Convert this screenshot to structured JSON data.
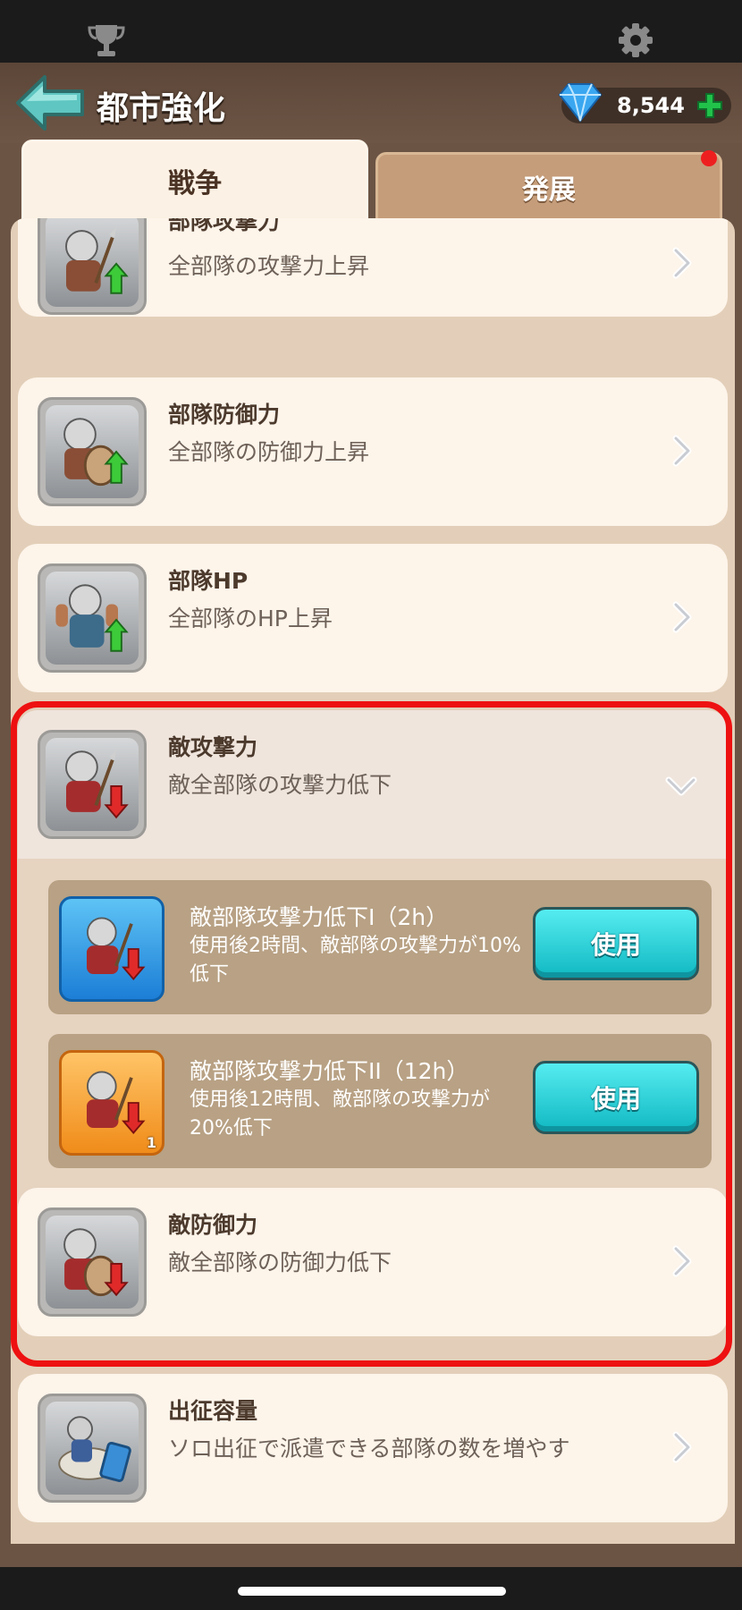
{
  "header": {
    "title": "都市強化",
    "gems": "8,544",
    "colors": {
      "gem": "#3aa7f0",
      "plus": "#21c24a"
    }
  },
  "tabs": [
    {
      "label": "戦争",
      "active": true
    },
    {
      "label": "発展",
      "active": false,
      "notification": true
    }
  ],
  "cards": [
    {
      "title": "部隊攻撃力",
      "desc": "全部隊の攻撃力上昇",
      "icon": "soldier-spear-attack-up-icon",
      "arrow": "up"
    },
    {
      "title": "部隊防御力",
      "desc": "全部隊の防御力上昇",
      "icon": "soldier-shield-defense-up-icon",
      "arrow": "up"
    },
    {
      "title": "部隊HP",
      "desc": "全部隊のHP上昇",
      "icon": "soldier-hp-up-icon",
      "arrow": "up"
    },
    {
      "title": "敵攻撃力",
      "desc": "敵全部隊の攻撃力低下",
      "icon": "enemy-attack-down-icon",
      "arrow": "down",
      "expanded": true
    },
    {
      "title": "敵防御力",
      "desc": "敵全部隊の防御力低下",
      "icon": "enemy-defense-down-icon",
      "arrow": "down"
    },
    {
      "title": "出征容量",
      "desc": "ソロ出征で派遣できる部隊の数を増やす",
      "icon": "knight-march-capacity-icon"
    }
  ],
  "items": [
    {
      "title": "敵部隊攻撃力低下I（2h）",
      "desc": "使用後2時間、敵部隊の攻撃力が10%低下",
      "button": "使用",
      "rarity": "blue"
    },
    {
      "title": "敵部隊攻撃力低下II（12h）",
      "desc": "使用後12時間、敵部隊の攻撃力が20%低下",
      "button": "使用",
      "rarity": "orange",
      "count": "1"
    }
  ]
}
